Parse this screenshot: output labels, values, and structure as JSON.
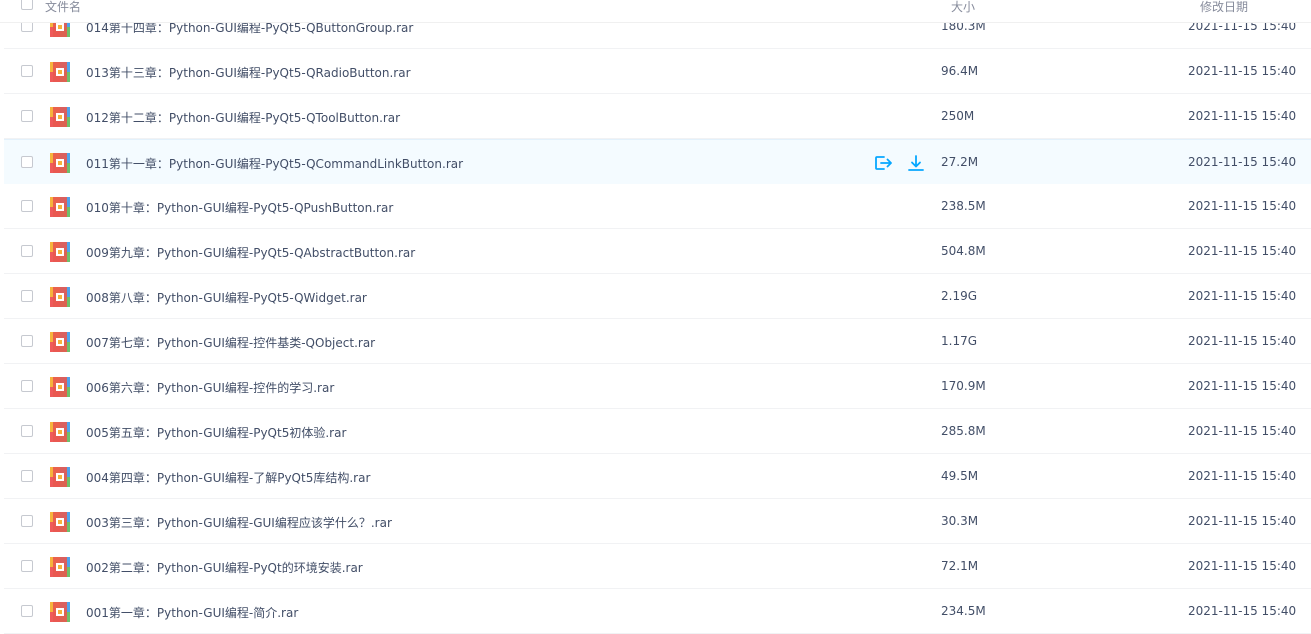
{
  "header": {
    "name_label": "文件名",
    "size_label": "大小",
    "date_label": "修改日期"
  },
  "files": [
    {
      "name": "014第十四章：Python-GUI编程-PyQt5-QButtonGroup.rar",
      "size": "180.3M",
      "date": "2021-11-15 15:40"
    },
    {
      "name": "013第十三章：Python-GUI编程-PyQt5-QRadioButton.rar",
      "size": "96.4M",
      "date": "2021-11-15 15:40"
    },
    {
      "name": "012第十二章：Python-GUI编程-PyQt5-QToolButton.rar",
      "size": "250M",
      "date": "2021-11-15 15:40"
    },
    {
      "name": "011第十一章：Python-GUI编程-PyQt5-QCommandLinkButton.rar",
      "size": "27.2M",
      "date": "2021-11-15 15:40",
      "hover": true
    },
    {
      "name": "010第十章：Python-GUI编程-PyQt5-QPushButton.rar",
      "size": "238.5M",
      "date": "2021-11-15 15:40"
    },
    {
      "name": "009第九章：Python-GUI编程-PyQt5-QAbstractButton.rar",
      "size": "504.8M",
      "date": "2021-11-15 15:40"
    },
    {
      "name": "008第八章：Python-GUI编程-PyQt5-QWidget.rar",
      "size": "2.19G",
      "date": "2021-11-15 15:40"
    },
    {
      "name": "007第七章：Python-GUI编程-控件基类-QObject.rar",
      "size": "1.17G",
      "date": "2021-11-15 15:40"
    },
    {
      "name": "006第六章：Python-GUI编程-控件的学习.rar",
      "size": "170.9M",
      "date": "2021-11-15 15:40"
    },
    {
      "name": "005第五章：Python-GUI编程-PyQt5初体验.rar",
      "size": "285.8M",
      "date": "2021-11-15 15:40"
    },
    {
      "name": "004第四章：Python-GUI编程-了解PyQt5库结构.rar",
      "size": "49.5M",
      "date": "2021-11-15 15:40"
    },
    {
      "name": "003第三章：Python-GUI编程-GUI编程应该学什么？.rar",
      "size": "30.3M",
      "date": "2021-11-15 15:40"
    },
    {
      "name": "002第二章：Python-GUI编程-PyQt的环境安装.rar",
      "size": "72.1M",
      "date": "2021-11-15 15:40"
    },
    {
      "name": "001第一章：Python-GUI编程-简介.rar",
      "size": "234.5M",
      "date": "2021-11-15 15:40"
    }
  ],
  "icons": {
    "file": "rar-archive-icon",
    "share": "share-icon",
    "download": "download-icon"
  },
  "colors": {
    "text": "#424e67",
    "header_text": "#878c9c",
    "hover_bg": "#f4fbff",
    "accent": "#06a7ff",
    "divider": "#f1f2f4"
  }
}
